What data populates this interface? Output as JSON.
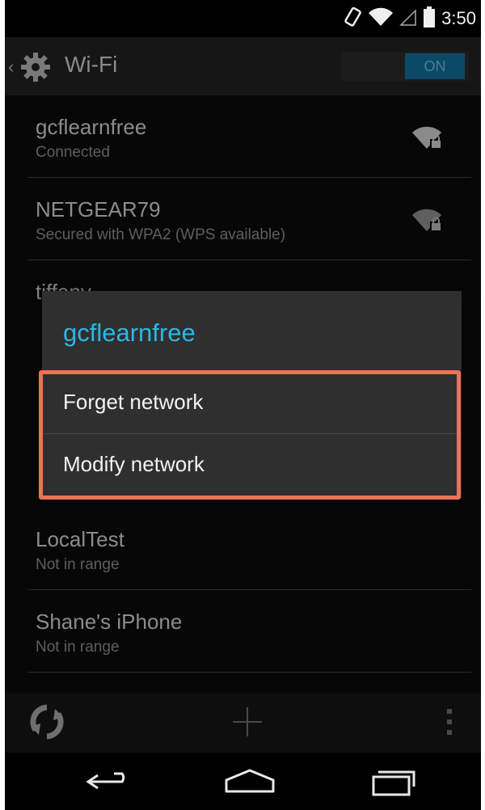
{
  "status_bar": {
    "time": "3:50",
    "icons": [
      "rotation-lock-icon",
      "wifi-signal-icon",
      "cell-signal-icon",
      "battery-icon"
    ]
  },
  "action_bar": {
    "title": "Wi-Fi",
    "toggle_label": "ON",
    "accent_color": "#0b4a66"
  },
  "networks": [
    {
      "name": "gcflearnfree",
      "status": "Connected"
    },
    {
      "name": "NETGEAR79",
      "status": "Secured with WPA2 (WPS available)"
    },
    {
      "name": "tiffany",
      "status": ""
    },
    {
      "name": "LocalTest",
      "status": "Not in range"
    },
    {
      "name": "Shane's iPhone",
      "status": "Not in range"
    }
  ],
  "dialog": {
    "title": "gcflearnfree",
    "title_color": "#2ab7e6",
    "items": [
      {
        "label": "Forget network"
      },
      {
        "label": "Modify network"
      }
    ],
    "highlight_color": "#ee7153"
  },
  "bottom_bar": {
    "icons": [
      "wps-push-icon",
      "add-network-icon",
      "overflow-menu-icon"
    ]
  },
  "nav_bar": {
    "icons": [
      "back-icon",
      "home-icon",
      "recent-apps-icon"
    ]
  }
}
